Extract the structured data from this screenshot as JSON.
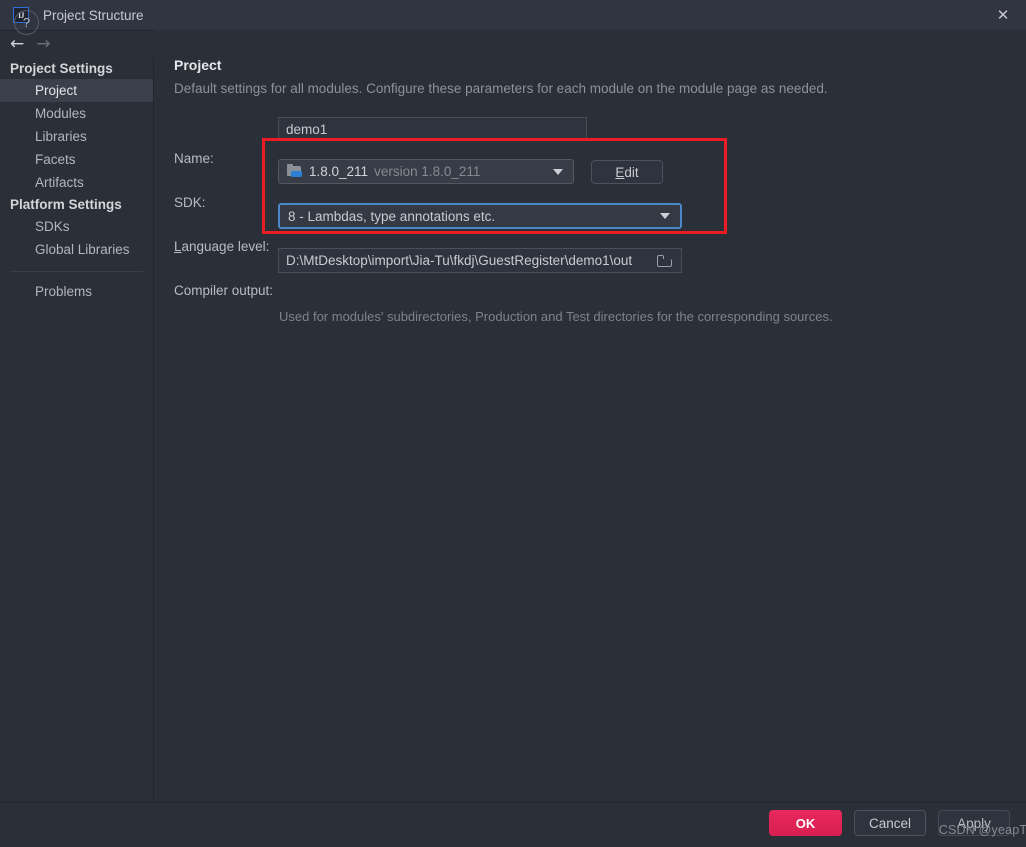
{
  "window": {
    "title": "Project Structure",
    "logo_text": "IJ",
    "close_label": "✕"
  },
  "toolbar": {
    "back_arrow": "←",
    "forward_arrow": "→"
  },
  "sidebar": {
    "groups": [
      {
        "label": "Project Settings",
        "items": [
          {
            "label": "Project",
            "selected": true
          },
          {
            "label": "Modules",
            "selected": false
          },
          {
            "label": "Libraries",
            "selected": false
          },
          {
            "label": "Facets",
            "selected": false
          },
          {
            "label": "Artifacts",
            "selected": false
          }
        ]
      },
      {
        "label": "Platform Settings",
        "items": [
          {
            "label": "SDKs",
            "selected": false
          },
          {
            "label": "Global Libraries",
            "selected": false
          }
        ]
      }
    ],
    "problems_label": "Problems"
  },
  "main": {
    "title": "Project",
    "description": "Default settings for all modules. Configure these parameters for each module on the module page as needed.",
    "name_label": "Name:",
    "name_value": "demo1",
    "sdk_label": "SDK:",
    "sdk_name": "1.8.0_211",
    "sdk_version": "version 1.8.0_211",
    "sdk_icon": "jdk-folder-icon",
    "edit_button": "Edit",
    "edit_mnemonic": "E",
    "edit_rest": "dit",
    "language_level_mnemonic": "L",
    "language_level_rest": "anguage level:",
    "language_level_value": "8 - Lambdas, type annotations etc.",
    "compiler_output_label": "Compiler output:",
    "compiler_output_value": "D:\\MtDesktop\\import\\Jia-Tu\\fkdj\\GuestRegister\\demo1\\out",
    "compiler_output_hint": "Used for modules' subdirectories, Production and Test directories for the corresponding sources."
  },
  "footer": {
    "help_label": "?",
    "ok_label": "OK",
    "cancel_label": "Cancel",
    "apply_label": "Apply",
    "watermark": "CSDN @yeapT"
  },
  "annotation": {
    "color": "#ec1c24",
    "description": "red-highlight-rectangle around SDK and Language level rows"
  }
}
